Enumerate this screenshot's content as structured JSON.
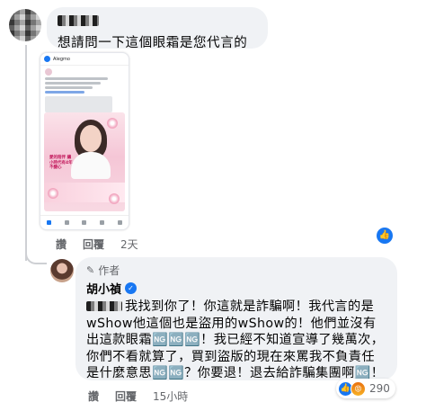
{
  "comment1": {
    "text": "想請問一下這個眼霜是您代言的嗎？",
    "actions": {
      "like": "讚",
      "reply": "回覆",
      "time": "2天"
    },
    "like_icon": "thumbs-up-icon"
  },
  "screenshot": {
    "app_name": "Alegmo",
    "tagline": "愛的陪伴 讓小時代有4年不變心"
  },
  "reply": {
    "author_badge": "作者",
    "author_name": "胡小禎",
    "verified_icon": "verified-badge-icon",
    "text": "我找到你了！你這就是詐騙啊！我代言的是wShow他這個也是盜用的wShow的！他們並沒有出這款眼霜🆖🆖🆖！我已經不知道宣導了幾萬次，你們不看就算了，買到盜版的現在來罵我不負責任是什麼意思🆖🆖？你要退！退去給詐騙集團啊🆖！",
    "actions": {
      "like": "讚",
      "reply": "回覆",
      "time": "15小時"
    },
    "reactions": {
      "count": "290",
      "icons": [
        "thumbs-up-icon",
        "angry-face-icon"
      ]
    }
  },
  "colors": {
    "accent": "#1877f2",
    "bubble": "#f0f2f5",
    "muted": "#65676b"
  }
}
